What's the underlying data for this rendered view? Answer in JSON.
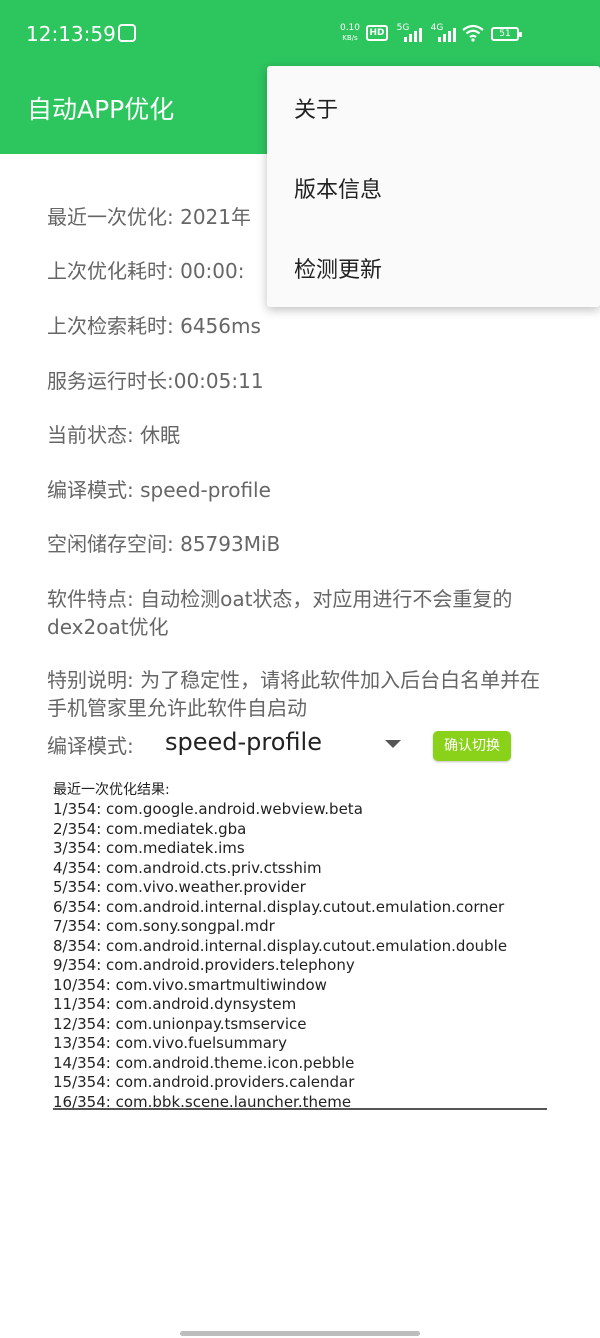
{
  "status_bar": {
    "time": "12:13:59",
    "net_speed_value": "0.10",
    "net_speed_unit": "KB/s",
    "hd_label": "HD",
    "sim1_label": "5G",
    "sim2_label": "4G",
    "battery_level": "51"
  },
  "app_bar": {
    "title": "自动APP优化"
  },
  "overflow_menu": {
    "items": [
      "关于",
      "版本信息",
      "检测更新"
    ]
  },
  "info": {
    "last_optimize": "最近一次优化: 2021年",
    "last_optimize_duration": "上次优化耗时: 00:00:",
    "last_search_duration": "上次检索耗时: 6456ms",
    "service_uptime": "服务运行时长:00:05:11",
    "current_state": "当前状态: 休眠",
    "compile_mode": "编译模式: speed-profile",
    "free_storage": "空闲储存空间: 85793MiB",
    "features": "软件特点: 自动检测oat状态，对应用进行不会重复的dex2oat优化",
    "note": "特别说明: 为了稳定性，请将此软件加入后台白名单并在手机管家里允许此软件自启动"
  },
  "mode_selector": {
    "label": "编译模式:",
    "selected": "speed-profile",
    "confirm_label": "确认切换"
  },
  "results": {
    "title": "最近一次优化结果:",
    "lines": [
      "1/354: com.google.android.webview.beta",
      "2/354: com.mediatek.gba",
      "3/354: com.mediatek.ims",
      "4/354: com.android.cts.priv.ctsshim",
      "5/354: com.vivo.weather.provider",
      "6/354: com.android.internal.display.cutout.emulation.corner",
      "7/354: com.sony.songpal.mdr",
      "8/354: com.android.internal.display.cutout.emulation.double",
      "9/354: com.android.providers.telephony",
      "10/354: com.vivo.smartmultiwindow",
      "11/354: com.android.dynsystem",
      "12/354: com.unionpay.tsmservice",
      "13/354: com.vivo.fuelsummary",
      "14/354: com.android.theme.icon.pebble",
      "15/354: com.android.providers.calendar",
      "16/354: com.bbk.scene.launcher.theme"
    ]
  },
  "colors": {
    "app_bar": "#2dc55e",
    "confirm_button": "#8ad11a"
  }
}
